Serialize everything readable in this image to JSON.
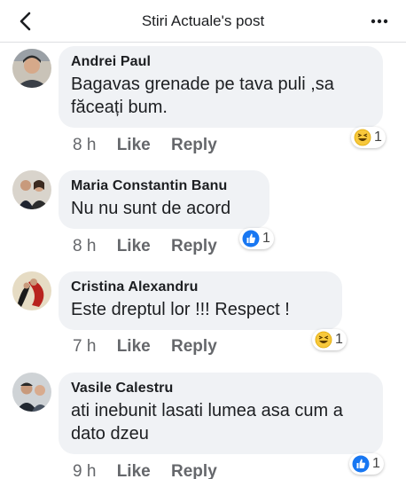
{
  "header": {
    "title": "Stiri Actuale's post",
    "back_icon": "back-chevron-icon",
    "more_icon": "more-dots-icon"
  },
  "comments": [
    {
      "author": "Andrei Paul",
      "text": "Bagavas grenade pe tava puli ,sa făceați bum.",
      "time": "8 h",
      "like": "Like",
      "reply": "Reply",
      "reaction": {
        "type": "haha",
        "count": "1"
      }
    },
    {
      "author": "Maria Constantin Banu",
      "text": "Nu nu sunt de acord",
      "time": "8 h",
      "like": "Like",
      "reply": "Reply",
      "reaction": {
        "type": "like",
        "count": "1"
      }
    },
    {
      "author": "Cristina Alexandru",
      "text": "Este dreptul  lor !!! Respect !",
      "time": "7 h",
      "like": "Like",
      "reply": "Reply",
      "reaction": {
        "type": "haha",
        "count": "1"
      }
    },
    {
      "author": "Vasile Calestru",
      "text": "ati inebunit lasati lumea asa cum a dato dzeu",
      "time": "9 h",
      "like": "Like",
      "reply": "Reply",
      "reaction": {
        "type": "like",
        "count": "1"
      }
    }
  ],
  "colors": {
    "bubble": "#f0f2f5",
    "meta_text": "#65676b",
    "like_blue": "#1877f2",
    "haha_yellow": "#f7c83c"
  }
}
